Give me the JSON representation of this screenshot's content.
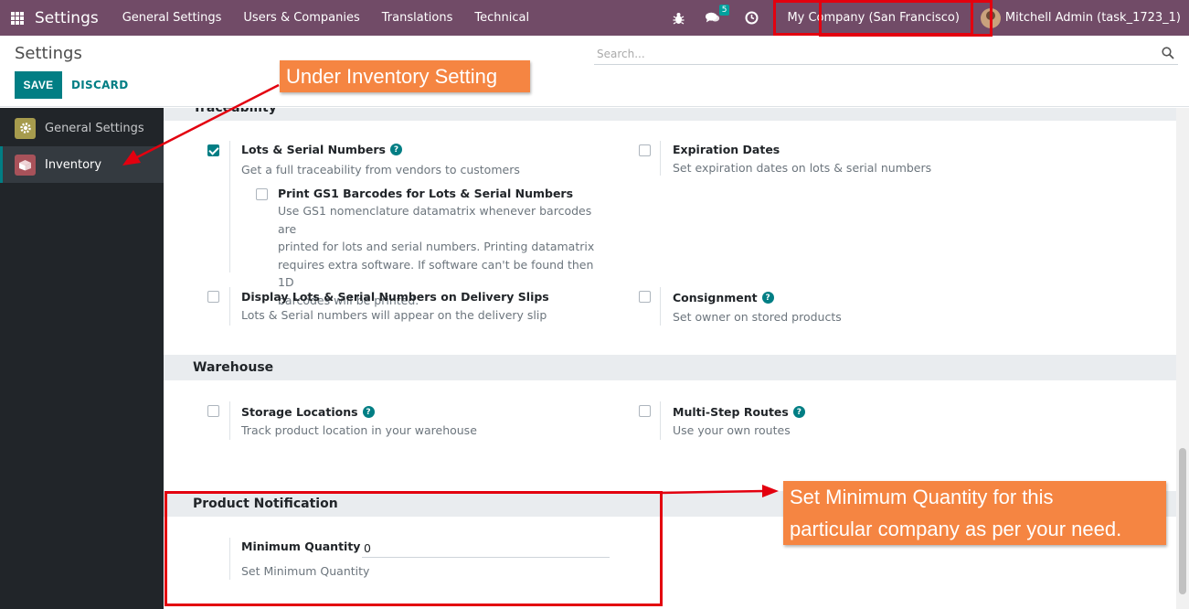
{
  "navbar": {
    "app_title": "Settings",
    "menus": [
      "General Settings",
      "Users & Companies",
      "Translations",
      "Technical"
    ],
    "messages_badge": "5",
    "company": "My Company (San Francisco)",
    "user": "Mitchell Admin (task_1723_1)"
  },
  "control_panel": {
    "title": "Settings",
    "save_label": "SAVE",
    "discard_label": "DISCARD",
    "search_placeholder": "Search..."
  },
  "sidebar": {
    "items": [
      {
        "label": "General Settings",
        "icon": "gear-icon",
        "active": false
      },
      {
        "label": "Inventory",
        "icon": "box-icon",
        "active": true
      }
    ]
  },
  "traceability": {
    "heading_partial": "Traceability",
    "lots_serial": {
      "title": "Lots & Serial Numbers",
      "desc": "Get a full traceability from vendors to customers",
      "checked": true
    },
    "gs1": {
      "title": "Print GS1 Barcodes for Lots & Serial Numbers",
      "desc_lines": [
        "Use GS1 nomenclature datamatrix whenever barcodes are",
        "printed for lots and serial numbers. Printing datamatrix",
        "requires extra software. If software can't be found then 1D",
        "barcodes will be printed."
      ],
      "checked": false
    },
    "expiration": {
      "title": "Expiration Dates",
      "desc": "Set expiration dates on lots & serial numbers",
      "checked": false
    },
    "display_lots": {
      "title": "Display Lots & Serial Numbers on Delivery Slips",
      "desc": "Lots & Serial numbers will appear on the delivery slip",
      "checked": false
    },
    "consignment": {
      "title": "Consignment",
      "desc": "Set owner on stored products",
      "checked": false
    }
  },
  "warehouse": {
    "heading": "Warehouse",
    "storage": {
      "title": "Storage Locations",
      "desc": "Track product location in your warehouse",
      "checked": false
    },
    "routes": {
      "title": "Multi-Step Routes",
      "desc": "Use your own routes",
      "checked": false
    }
  },
  "product_notification": {
    "heading": "Product Notification",
    "min_qty_label": "Minimum Quantity",
    "min_qty_value": "0",
    "min_qty_desc": "Set Minimum Quantity"
  },
  "annotations": {
    "callout_inventory": "Under Inventory Setting",
    "callout_min_qty_lines": [
      "Set Minimum Quantity for this",
      "particular company as per your need."
    ]
  },
  "colors": {
    "navbar": "#714b67",
    "primary": "#017e84",
    "annotation_red": "#e3000f",
    "callout_orange": "#f58542"
  }
}
